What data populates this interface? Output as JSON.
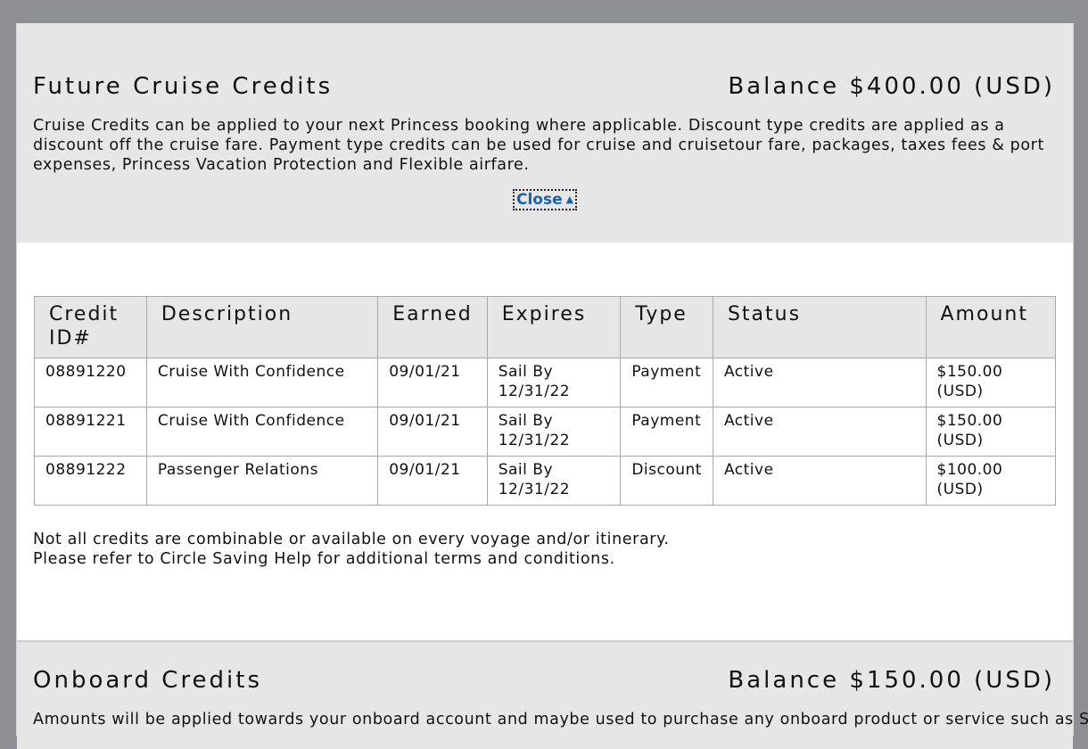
{
  "future_credits": {
    "title": "Future Cruise Credits",
    "balance": "Balance $400.00 (USD)",
    "description": "Cruise Credits can be applied to your next Princess booking where applicable. Discount type credits are applied as a discount off the cruise fare. Payment type credits can be used for cruise and cruisetour fare, packages, taxes fees & port expenses, Princess Vacation Protection and Flexible airfare.",
    "close_label": "Close",
    "close_icon": "caret-up-icon",
    "table": {
      "headers": [
        "Credit ID#",
        "Description",
        "Earned",
        "Expires",
        "Type",
        "Status",
        "Amount"
      ],
      "rows": [
        {
          "id": "08891220",
          "description": "Cruise With Confidence",
          "earned": "09/01/21",
          "expires": "Sail By 12/31/22",
          "type": "Payment",
          "status": "Active",
          "amount": "$150.00 (USD)"
        },
        {
          "id": "08891221",
          "description": "Cruise With Confidence",
          "earned": "09/01/21",
          "expires": "Sail By 12/31/22",
          "type": "Payment",
          "status": "Active",
          "amount": "$150.00 (USD)"
        },
        {
          "id": "08891222",
          "description": "Passenger Relations",
          "earned": "09/01/21",
          "expires": "Sail By 12/31/22",
          "type": "Discount",
          "status": "Active",
          "amount": "$100.00 (USD)"
        }
      ]
    },
    "note_line1": "Not all credits are combinable or available on every voyage and/or itinerary.",
    "note_line2": "Please refer to Circle Saving Help for additional terms and conditions."
  },
  "onboard_credits": {
    "title": "Onboard Credits",
    "balance": "Balance $150.00 (USD)",
    "description": "Amounts will be applied towards your onboard account and maybe used to purchase any onboard product or service such as Shore"
  },
  "colors": {
    "page_bg": "#8e8f94",
    "header_bg": "#e6e6e6",
    "link": "#1e5fa8",
    "border": "#a8a8a8"
  }
}
